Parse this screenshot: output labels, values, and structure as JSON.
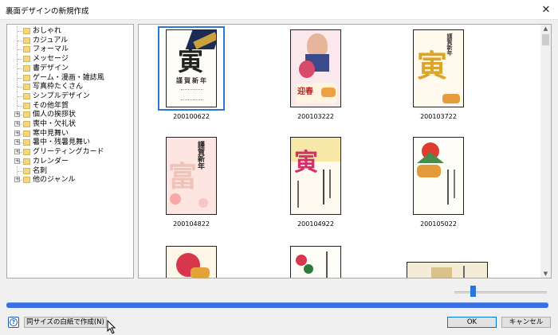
{
  "window": {
    "title": "裏面デザインの新規作成"
  },
  "tree": {
    "items": [
      {
        "label": "おしゃれ",
        "expandable": false
      },
      {
        "label": "カジュアル",
        "expandable": false
      },
      {
        "label": "フォーマル",
        "expandable": false
      },
      {
        "label": "メッセージ",
        "expandable": false
      },
      {
        "label": "書デザイン",
        "expandable": false
      },
      {
        "label": "ゲーム・漫画・雑誌風",
        "expandable": false
      },
      {
        "label": "写真枠たくさん",
        "expandable": false
      },
      {
        "label": "シンプルデザイン",
        "expandable": false
      },
      {
        "label": "その他年賀",
        "expandable": false
      },
      {
        "label": "個人の挨拶状",
        "expandable": true
      },
      {
        "label": "喪中・欠礼状",
        "expandable": true
      },
      {
        "label": "寒中見舞い",
        "expandable": true
      },
      {
        "label": "暑中・残暑見舞い",
        "expandable": true
      },
      {
        "label": "グリーティングカード",
        "expandable": true
      },
      {
        "label": "カレンダー",
        "expandable": true
      },
      {
        "label": "名刺",
        "expandable": false
      },
      {
        "label": "他のジャンル",
        "expandable": true
      }
    ]
  },
  "gallery": {
    "tiles": [
      {
        "caption": "200100622",
        "selected": true
      },
      {
        "caption": "200103222",
        "selected": false
      },
      {
        "caption": "200103722",
        "selected": false
      },
      {
        "caption": "200104822",
        "selected": false
      },
      {
        "caption": "200104922",
        "selected": false
      },
      {
        "caption": "200105022",
        "selected": false
      },
      {
        "caption": "",
        "selected": false
      },
      {
        "caption": "",
        "selected": false
      },
      {
        "caption": "",
        "selected": false
      }
    ],
    "card_text": {
      "tora": "寅",
      "greeting": "謹賀新年",
      "geishun": "迎春",
      "tomi": "富"
    }
  },
  "zoom": {
    "level": 0.2
  },
  "buttons": {
    "help": "?",
    "blank": "同サイズの白紙で作成(N)",
    "ok": "OK",
    "cancel": "キャンセル"
  },
  "colors": {
    "accent": "#2b78cf",
    "progress": "#3c6fe0",
    "folder": "#f7d775"
  }
}
